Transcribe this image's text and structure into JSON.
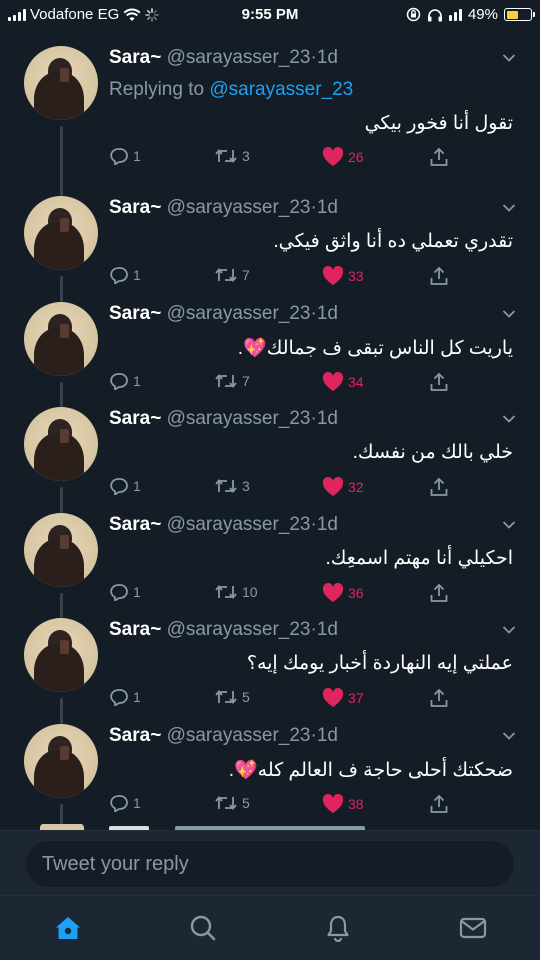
{
  "status_bar": {
    "carrier": "Vodafone EG",
    "time": "9:55 PM",
    "battery": "49%",
    "battery_level": 0.49
  },
  "tweets": [
    {
      "name": "Sara~",
      "handle": "@sarayasser_23",
      "time": "1d",
      "replying_prefix": "Replying to",
      "replying_to": "@sarayasser_23",
      "text": "تقول أنا فخور بيكي",
      "replies": "1",
      "retweets": "3",
      "likes": "26"
    },
    {
      "name": "Sara~",
      "handle": "@sarayasser_23",
      "time": "1d",
      "text": "تقدري تعملي ده أنا واثق فيكي.",
      "replies": "1",
      "retweets": "7",
      "likes": "33"
    },
    {
      "name": "Sara~",
      "handle": "@sarayasser_23",
      "time": "1d",
      "text": "ياريت كل الناس تبقى ف جمالك💖.",
      "replies": "1",
      "retweets": "7",
      "likes": "34"
    },
    {
      "name": "Sara~",
      "handle": "@sarayasser_23",
      "time": "1d",
      "text": "خلي بالك من نفسك.",
      "replies": "1",
      "retweets": "3",
      "likes": "32"
    },
    {
      "name": "Sara~",
      "handle": "@sarayasser_23",
      "time": "1d",
      "text": "احكيلي أنا مهتم اسمعِك.",
      "replies": "1",
      "retweets": "10",
      "likes": "36"
    },
    {
      "name": "Sara~",
      "handle": "@sarayasser_23",
      "time": "1d",
      "text": "عملتي إيه النهاردة أخبار يومك إيه؟",
      "replies": "1",
      "retweets": "5",
      "likes": "37"
    },
    {
      "name": "Sara~",
      "handle": "@sarayasser_23",
      "time": "1d",
      "text": "ضحكتك أحلى حاجة ف العالم كله💖.",
      "replies": "1",
      "retweets": "5",
      "likes": "38"
    }
  ],
  "reply_bar": {
    "placeholder": "Tweet your reply"
  },
  "tab_bar": [
    {
      "name": "home",
      "icon": "home-icon",
      "active": true
    },
    {
      "name": "search",
      "icon": "search-icon",
      "active": false
    },
    {
      "name": "notifications",
      "icon": "bell-icon",
      "active": false
    },
    {
      "name": "messages",
      "icon": "mail-icon",
      "active": false
    }
  ],
  "colors": {
    "background": "#141d26",
    "accent": "#1da1f2",
    "like": "#e0245e",
    "muted": "#8899a6"
  }
}
